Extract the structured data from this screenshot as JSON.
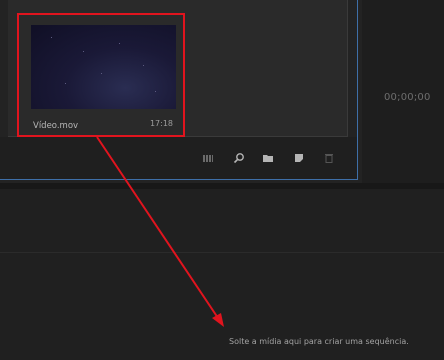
{
  "project_panel": {
    "clip": {
      "name": "Vídeo.mov",
      "duration": "17:18"
    },
    "toolbar": {
      "icons": [
        "metadata-bars-icon",
        "search-icon",
        "folder-icon",
        "new-item-icon",
        "trash-icon"
      ]
    }
  },
  "program_monitor": {
    "timecode": "00;00;00"
  },
  "timeline": {
    "drop_hint": "Solte a mídia aqui para criar uma sequência."
  },
  "annotation": {
    "highlight_color": "#e1141e",
    "arrow_color": "#e1141e"
  }
}
